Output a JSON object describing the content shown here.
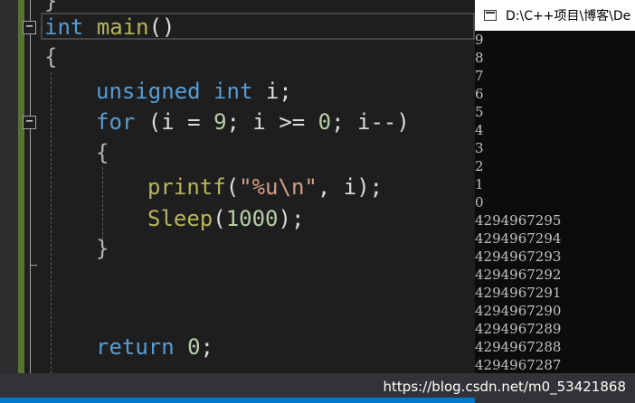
{
  "editor": {
    "code": {
      "kw_int": "int",
      "fn_main": "main",
      "parens": "()",
      "open_brace": "{",
      "kw_unsigned": "unsigned",
      "kw_int2": "int",
      "decl_tail": " i;",
      "kw_for": "for",
      "for_a": " (i = ",
      "for_n9": "9",
      "for_b": "; i >= ",
      "for_n0": "0",
      "for_c": "; i--)",
      "inner_open": "{",
      "fn_printf": "printf",
      "pf_open": "(",
      "str_a": "\"%u",
      "str_esc": "\\n",
      "str_b": "\"",
      "pf_tail": ", i);",
      "fn_sleep": "Sleep",
      "sl_open": "(",
      "sl_num": "1000",
      "sl_close": ");",
      "inner_close": "}",
      "kw_return": "return",
      "ret_num": "0",
      "ret_semi": ";",
      "top_brace": "}"
    },
    "fold_symbol": "−"
  },
  "console": {
    "title": "D:\\C++项目\\博客\\De",
    "icon": "console-window-icon",
    "output": [
      "9",
      "8",
      "7",
      "6",
      "5",
      "4",
      "3",
      "2",
      "1",
      "0",
      "4294967295",
      "4294967294",
      "4294967293",
      "4294967292",
      "4294967291",
      "4294967290",
      "4294967289",
      "4294967288",
      "4294967287"
    ]
  },
  "watermark": "https://blog.csdn.net/m0_53421868",
  "colors": {
    "keyword": "#569cd6",
    "function": "#b5b55a",
    "number": "#b5cea8",
    "string": "#d69d85",
    "editor_bg": "#1e1e1e",
    "console_bg": "#0c0c0c",
    "change_bar": "#577430"
  }
}
